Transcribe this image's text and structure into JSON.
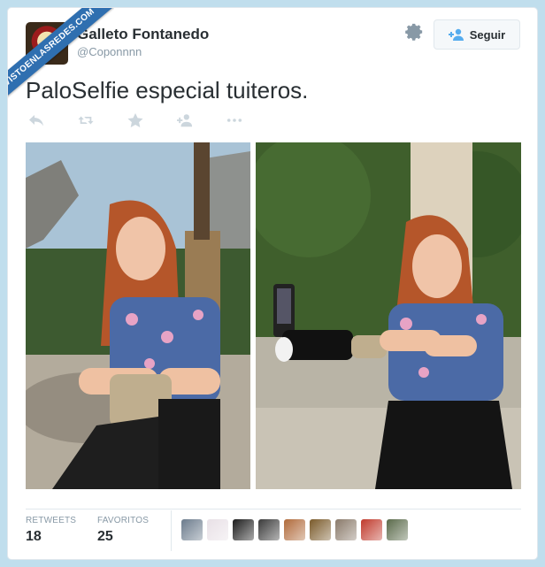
{
  "watermark": {
    "text": "VISTOENLASREDES.COM"
  },
  "author": {
    "name": "Galleto Fontanedo",
    "handle": "@Coponnnn"
  },
  "header": {
    "follow_label": "Seguir"
  },
  "tweet": {
    "text": "PaloSelfie especial tuiteros."
  },
  "actions": [
    "reply-icon",
    "retweet-icon",
    "favorite-icon",
    "follow-icon",
    "more-icon"
  ],
  "stats": {
    "retweets_label": "RETWEETS",
    "retweets_value": "18",
    "favorites_label": "FAVORITOS",
    "favorites_value": "25"
  },
  "favoriters": [
    {
      "color": "#6b7b8c"
    },
    {
      "color": "#e8e0e6"
    },
    {
      "color": "#1c1c1c"
    },
    {
      "color": "#3a3a3a"
    },
    {
      "color": "#b06a3a"
    },
    {
      "color": "#7a5a2a"
    },
    {
      "color": "#8a7a6a"
    },
    {
      "color": "#c0392b"
    },
    {
      "color": "#5a6a4a"
    }
  ],
  "colors": {
    "background": "#c0deed",
    "ribbon": "#2f6fb0",
    "text": "#292f33",
    "muted": "#8899a6"
  }
}
